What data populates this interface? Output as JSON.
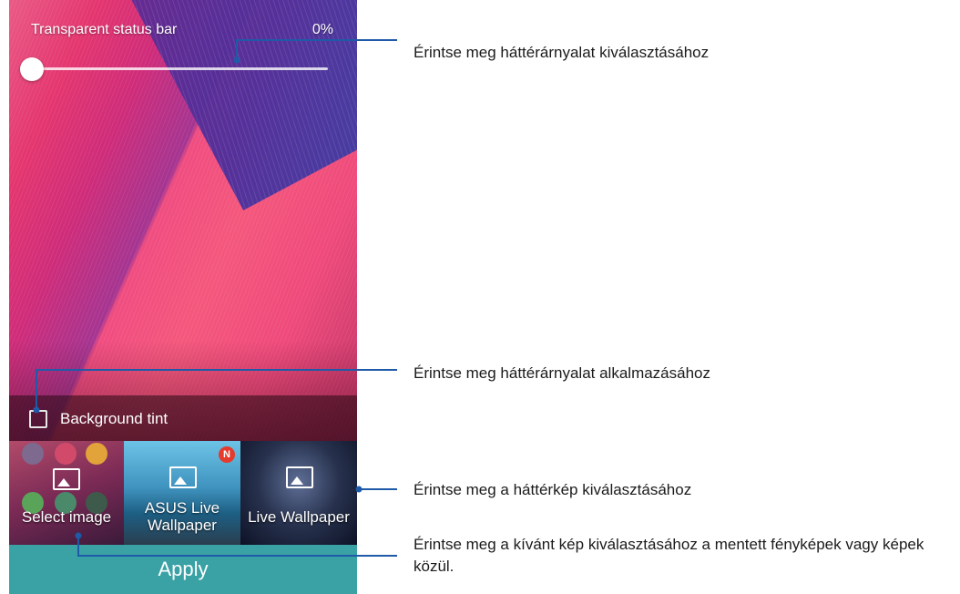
{
  "screen": {
    "status_bar_label": "Transparent status bar",
    "status_bar_percent": "0%",
    "slider_value_percent": 0,
    "background_tint_label": "Background tint",
    "background_tint_checked": false,
    "picker": {
      "select_image": "Select image",
      "asus_live_wallpaper": "ASUS Live Wallpaper",
      "asus_badge": "N",
      "live_wallpaper": "Live Wallpaper"
    },
    "apply_label": "Apply"
  },
  "callouts": {
    "tint_choose": "Érintse meg háttérárnyalat kiválasztásához",
    "tint_apply": "Érintse meg háttérárnyalat alkalmazásához",
    "wallpaper_choose": "Érintse meg a háttérkép kiválasztásához",
    "image_choose": "Érintse meg a kívánt kép kiválasztásához a mentett fényképek vagy képek közül."
  },
  "colors": {
    "apply_bar": "#3aa1a5",
    "leader_line": "#1f5aa8"
  }
}
